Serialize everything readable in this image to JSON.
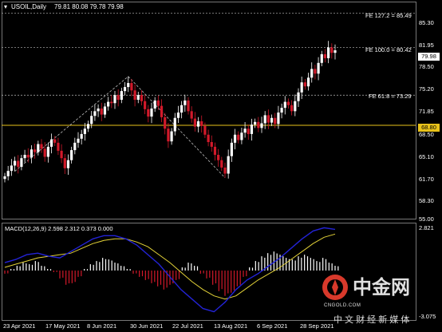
{
  "chart_header": {
    "symbol_label": "USOIL,Daily",
    "ohlc_values": "79.81 80.08 79.78 79.98"
  },
  "fib_levels": [
    {
      "label": "FE 127.2 = 85.49",
      "value": 85.49
    },
    {
      "label": "FE 100.0 = 80.42",
      "value": 80.42
    },
    {
      "label": "FE 61.8 = 73.29",
      "value": 73.29
    }
  ],
  "horizontal_line": {
    "value": 68.8,
    "label": "68.80",
    "color": "#e8c21a"
  },
  "current_price": {
    "value": 79.98,
    "label": "79.98"
  },
  "price_axis_ticks": [
    "85.30",
    "81.95",
    "78.50",
    "75.20",
    "71.85",
    "68.50",
    "65.10",
    "61.70",
    "58.30",
    "55.00"
  ],
  "date_axis_ticks": [
    "23 Apr 2021",
    "17 May 2021",
    "8 Jun 2021",
    "30 Jun 2021",
    "22 Jul 2021",
    "13 Aug 2021",
    "6 Sep 2021",
    "28 Sep 2021"
  ],
  "macd": {
    "label": "MACD(12,26,9) 2.598 2.312 0.373 0.000",
    "axis_top": "2.821",
    "axis_bottom": "-3.075"
  },
  "watermark": {
    "brand_cn": "中金网",
    "brand_domain": "CNGOLD.COM",
    "tagline_cn": "中 文 财 经 新 媒 体"
  },
  "colors": {
    "bull": "#ffffff",
    "bear": "#d2192a",
    "macd_line": "#2323d6",
    "signal_line": "#e3d238",
    "grid": "#666666",
    "fib": "#bbbbbb",
    "brand_red": "#d8392b"
  },
  "chart_data": {
    "type": "candlestick",
    "symbol": "USOIL",
    "timeframe": "Daily",
    "x_dates": [
      "23 Apr 2021",
      "17 May 2021",
      "8 Jun 2021",
      "30 Jun 2021",
      "22 Jul 2021",
      "13 Aug 2021",
      "6 Sep 2021",
      "28 Sep 2021"
    ],
    "ylim": [
      55.0,
      87.0
    ],
    "close_path": [
      61.2,
      62.0,
      62.8,
      63.5,
      62.6,
      63.9,
      64.4,
      64.0,
      65.2,
      64.8,
      66.0,
      65.3,
      64.1,
      65.6,
      66.7,
      66.2,
      65.0,
      63.9,
      62.4,
      63.6,
      65.1,
      66.2,
      66.8,
      67.5,
      68.3,
      69.0,
      70.2,
      70.9,
      71.3,
      70.4,
      71.6,
      72.3,
      72.1,
      73.3,
      72.6,
      73.9,
      74.5,
      75.1,
      74.0,
      72.6,
      73.3,
      72.4,
      71.2,
      70.1,
      71.3,
      72.5,
      71.7,
      70.0,
      68.3,
      66.4,
      67.9,
      69.9,
      70.7,
      71.8,
      72.5,
      70.9,
      69.8,
      68.6,
      69.4,
      68.7,
      67.4,
      66.3,
      65.6,
      64.4,
      63.6,
      62.5,
      61.6,
      64.2,
      66.2,
      67.4,
      66.6,
      67.7,
      68.3,
      67.5,
      68.9,
      69.3,
      68.4,
      69.1,
      70.3,
      69.2,
      69.9,
      69.0,
      70.7,
      71.4,
      72.3,
      71.8,
      70.9,
      72.4,
      73.7,
      75.2,
      74.6,
      75.9,
      77.2,
      76.5,
      78.1,
      79.4,
      78.8,
      80.4,
      79.6,
      79.98
    ],
    "macd_hist_path": [
      -0.2,
      0.1,
      0.3,
      0.5,
      0.4,
      0.6,
      0.3,
      0.1,
      -0.1,
      -0.5,
      -0.9,
      -0.8,
      -0.4,
      0.1,
      0.4,
      0.6,
      0.8,
      0.7,
      0.5,
      0.3,
      0.1,
      -0.2,
      -0.4,
      -0.6,
      -0.8,
      -1.0,
      -1.2,
      -0.9,
      -0.6,
      0.2,
      0.5,
      0.3,
      -0.2,
      -0.5,
      -0.9,
      -1.3,
      -1.6,
      -1.4,
      -1.0,
      -0.4,
      0.2,
      0.6,
      0.9,
      1.1,
      1.2,
      1.0,
      0.8,
      0.7,
      0.9,
      1.0,
      0.8,
      0.6,
      0.8,
      0.5,
      0.3
    ],
    "macd_line": [
      0.5,
      0.7,
      1.0,
      1.1,
      0.9,
      0.8,
      1.2,
      1.6,
      2.0,
      2.2,
      2.2,
      2.0,
      1.6,
      1.0,
      0.4,
      -0.4,
      -1.2,
      -1.8,
      -2.4,
      -2.6,
      -2.0,
      -1.2,
      -0.6,
      -0.2,
      0.3,
      0.8,
      1.4,
      2.0,
      2.5,
      2.7,
      2.6
    ],
    "signal_line": [
      0.2,
      0.4,
      0.6,
      0.8,
      0.9,
      1.0,
      1.1,
      1.4,
      1.7,
      1.9,
      2.0,
      2.0,
      1.8,
      1.5,
      1.0,
      0.5,
      -0.1,
      -0.7,
      -1.2,
      -1.6,
      -1.8,
      -1.6,
      -1.1,
      -0.6,
      -0.2,
      0.2,
      0.7,
      1.2,
      1.7,
      2.1,
      2.3
    ],
    "macd_ylim": [
      -3.075,
      2.821
    ]
  }
}
